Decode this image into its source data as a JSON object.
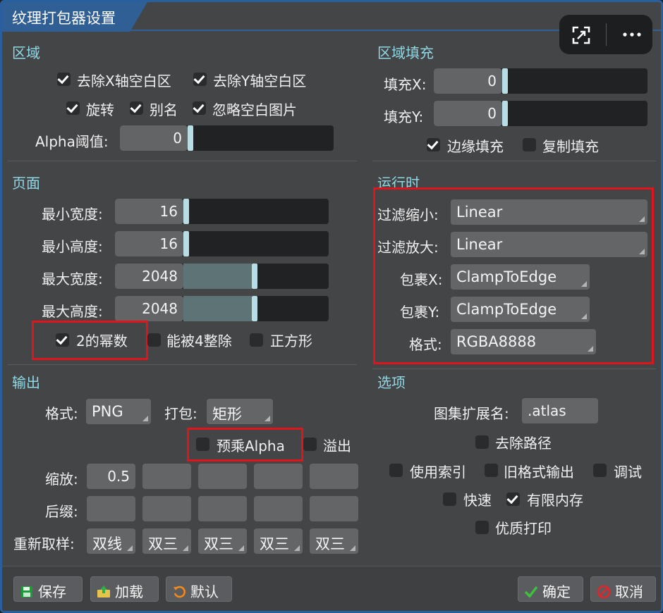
{
  "window": {
    "title": "纹理打包器设置"
  },
  "sections": {
    "region": "区域",
    "region_fill": "区域填充",
    "pages": "页面",
    "runtime": "运行时",
    "output": "输出",
    "options": "选项"
  },
  "region": {
    "strip_x": "去除X轴空白区",
    "strip_y": "去除Y轴空白区",
    "rotation": "旋转",
    "alias": "别名",
    "ignore_blank": "忽略空白图片",
    "alpha_threshold_label": "Alpha阈值:",
    "alpha_threshold_value": "0"
  },
  "region_fill": {
    "fill_x_label": "填充X:",
    "fill_x_value": "0",
    "fill_y_label": "填充Y:",
    "fill_y_value": "0",
    "edge_padding": "边缘填充",
    "duplicate_padding": "复制填充"
  },
  "pages": {
    "min_width_label": "最小宽度:",
    "min_width_value": "16",
    "min_height_label": "最小高度:",
    "min_height_value": "16",
    "max_width_label": "最大宽度:",
    "max_width_value": "2048",
    "max_height_label": "最大高度:",
    "max_height_value": "2048",
    "power_of_two": "2的幂数",
    "divisible_by_4": "能被4整除",
    "square": "正方形"
  },
  "runtime": {
    "filter_min_label": "过滤缩小:",
    "filter_min_value": "Linear",
    "filter_mag_label": "过滤放大:",
    "filter_mag_value": "Linear",
    "wrap_x_label": "包裹X:",
    "wrap_x_value": "ClampToEdge",
    "wrap_y_label": "包裹Y:",
    "wrap_y_value": "ClampToEdge",
    "format_label": "格式:",
    "format_value": "RGBA8888"
  },
  "output": {
    "format_label": "格式:",
    "format_value": "PNG",
    "packing_label": "打包:",
    "packing_value": "矩形",
    "premultiply_alpha": "预乘Alpha",
    "bleed": "溢出",
    "scale_label": "缩放:",
    "scale_values": [
      "0.5",
      "",
      "",
      "",
      ""
    ],
    "suffix_label": "后缀:",
    "resample_label": "重新取样:",
    "resample_first": "双线",
    "resample_others": [
      "双三",
      "双三",
      "双三",
      "双三"
    ]
  },
  "options": {
    "atlas_ext_label": "图集扩展名:",
    "atlas_ext_value": ".atlas",
    "flatten_paths": "去除路径",
    "use_indexes": "使用索引",
    "legacy_output": "旧格式输出",
    "debug": "调试",
    "fast": "快速",
    "limit_memory": "有限内存",
    "pretty_print": "优质打印"
  },
  "footer": {
    "save": "保存",
    "load": "加载",
    "defaults": "默认",
    "ok": "确定",
    "cancel": "取消"
  },
  "colors": {
    "accent": "#2f5f94",
    "section_title": "#8fd8e6",
    "highlight_box": "#e0141c"
  }
}
